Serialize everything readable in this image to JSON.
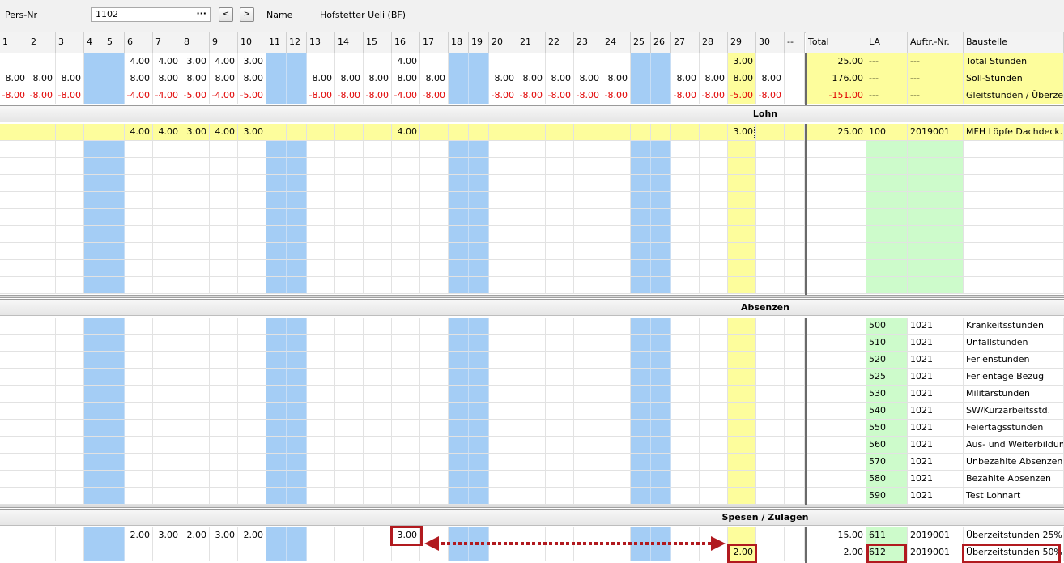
{
  "header": {
    "pers_label": "Pers-Nr",
    "pers_value": "1102",
    "lookup_glyph": "···",
    "prev_glyph": "<",
    "next_glyph": ">",
    "name_label": "Name",
    "name_value": "Hofstetter Ueli (BF)"
  },
  "columns": {
    "days": [
      "1",
      "2",
      "3",
      "4",
      "5",
      "6",
      "7",
      "8",
      "9",
      "10",
      "11",
      "12",
      "13",
      "14",
      "15",
      "16",
      "17",
      "18",
      "19",
      "20",
      "21",
      "22",
      "23",
      "24",
      "25",
      "26",
      "27",
      "28",
      "29",
      "30",
      "--"
    ],
    "total": "Total",
    "la": "LA",
    "auftr": "Auftr.-Nr.",
    "baustelle": "Baustelle"
  },
  "weekend_days": [
    4,
    5,
    11,
    12,
    18,
    19,
    25,
    26
  ],
  "highlight_day": 29,
  "summary_rows": [
    {
      "cells": {
        "6": "4.00",
        "7": "4.00",
        "8": "3.00",
        "9": "4.00",
        "10": "3.00",
        "16": "4.00",
        "29": "3.00"
      },
      "total": "25.00",
      "la": "---",
      "auftr": "---",
      "baustelle": "Total Stunden",
      "negative": false
    },
    {
      "cells": {
        "1": "8.00",
        "2": "8.00",
        "3": "8.00",
        "6": "8.00",
        "7": "8.00",
        "8": "8.00",
        "9": "8.00",
        "10": "8.00",
        "13": "8.00",
        "14": "8.00",
        "15": "8.00",
        "16": "8.00",
        "17": "8.00",
        "20": "8.00",
        "21": "8.00",
        "22": "8.00",
        "23": "8.00",
        "24": "8.00",
        "27": "8.00",
        "28": "8.00",
        "29": "8.00",
        "30": "8.00"
      },
      "total": "176.00",
      "la": "---",
      "auftr": "---",
      "baustelle": "Soll-Stunden",
      "negative": false
    },
    {
      "cells": {
        "1": "-8.00",
        "2": "-8.00",
        "3": "-8.00",
        "6": "-4.00",
        "7": "-4.00",
        "8": "-5.00",
        "9": "-4.00",
        "10": "-5.00",
        "13": "-8.00",
        "14": "-8.00",
        "15": "-8.00",
        "16": "-4.00",
        "17": "-8.00",
        "20": "-8.00",
        "21": "-8.00",
        "22": "-8.00",
        "23": "-8.00",
        "24": "-8.00",
        "27": "-8.00",
        "28": "-8.00",
        "29": "-5.00",
        "30": "-8.00"
      },
      "total": "-151.00",
      "la": "---",
      "auftr": "---",
      "baustelle": "Gleitstunden / Überzeit",
      "negative": true
    }
  ],
  "sections": {
    "lohn": "Lohn",
    "absenzen": "Absenzen",
    "spesen": "Spesen / Zulagen"
  },
  "lohn_rows": [
    {
      "cells": {
        "6": "4.00",
        "7": "4.00",
        "8": "3.00",
        "9": "4.00",
        "10": "3.00",
        "16": "4.00",
        "29": "3.00"
      },
      "total": "25.00",
      "la": "100",
      "auftr": "2019001",
      "baustelle": "MFH Löpfe Dachdeck..."
    }
  ],
  "absenzen_rows": [
    {
      "la": "500",
      "auftr": "1021",
      "baustelle": "Krankeitsstunden"
    },
    {
      "la": "510",
      "auftr": "1021",
      "baustelle": "Unfallstunden"
    },
    {
      "la": "520",
      "auftr": "1021",
      "baustelle": "Ferienstunden"
    },
    {
      "la": "525",
      "auftr": "1021",
      "baustelle": "Ferientage Bezug"
    },
    {
      "la": "530",
      "auftr": "1021",
      "baustelle": "Militärstunden"
    },
    {
      "la": "540",
      "auftr": "1021",
      "baustelle": "SW/Kurzarbeitsstd."
    },
    {
      "la": "550",
      "auftr": "1021",
      "baustelle": "Feiertagsstunden"
    },
    {
      "la": "560",
      "auftr": "1021",
      "baustelle": "Aus- und Weiterbildung"
    },
    {
      "la": "570",
      "auftr": "1021",
      "baustelle": "Unbezahlte Absenzen"
    },
    {
      "la": "580",
      "auftr": "1021",
      "baustelle": "Bezahlte Absenzen"
    },
    {
      "la": "590",
      "auftr": "1021",
      "baustelle": "Test Lohnart"
    }
  ],
  "spesen_rows": [
    {
      "cells": {
        "6": "2.00",
        "7": "3.00",
        "8": "2.00",
        "9": "3.00",
        "10": "2.00",
        "16": "3.00"
      },
      "total": "15.00",
      "la": "611",
      "auftr": "2019001",
      "baustelle": "Überzeitstunden 25%"
    },
    {
      "cells": {
        "29": "2.00"
      },
      "total": "2.00",
      "la": "612",
      "auftr": "2019001",
      "baustelle": "Überzeitstunden 50%"
    }
  ],
  "colors": {
    "weekend": "#a4cdf5",
    "highlight": "#fdfd9c",
    "la_column": "#cdfbcb",
    "negative": "#e00000",
    "annotation": "#b11a1f"
  }
}
